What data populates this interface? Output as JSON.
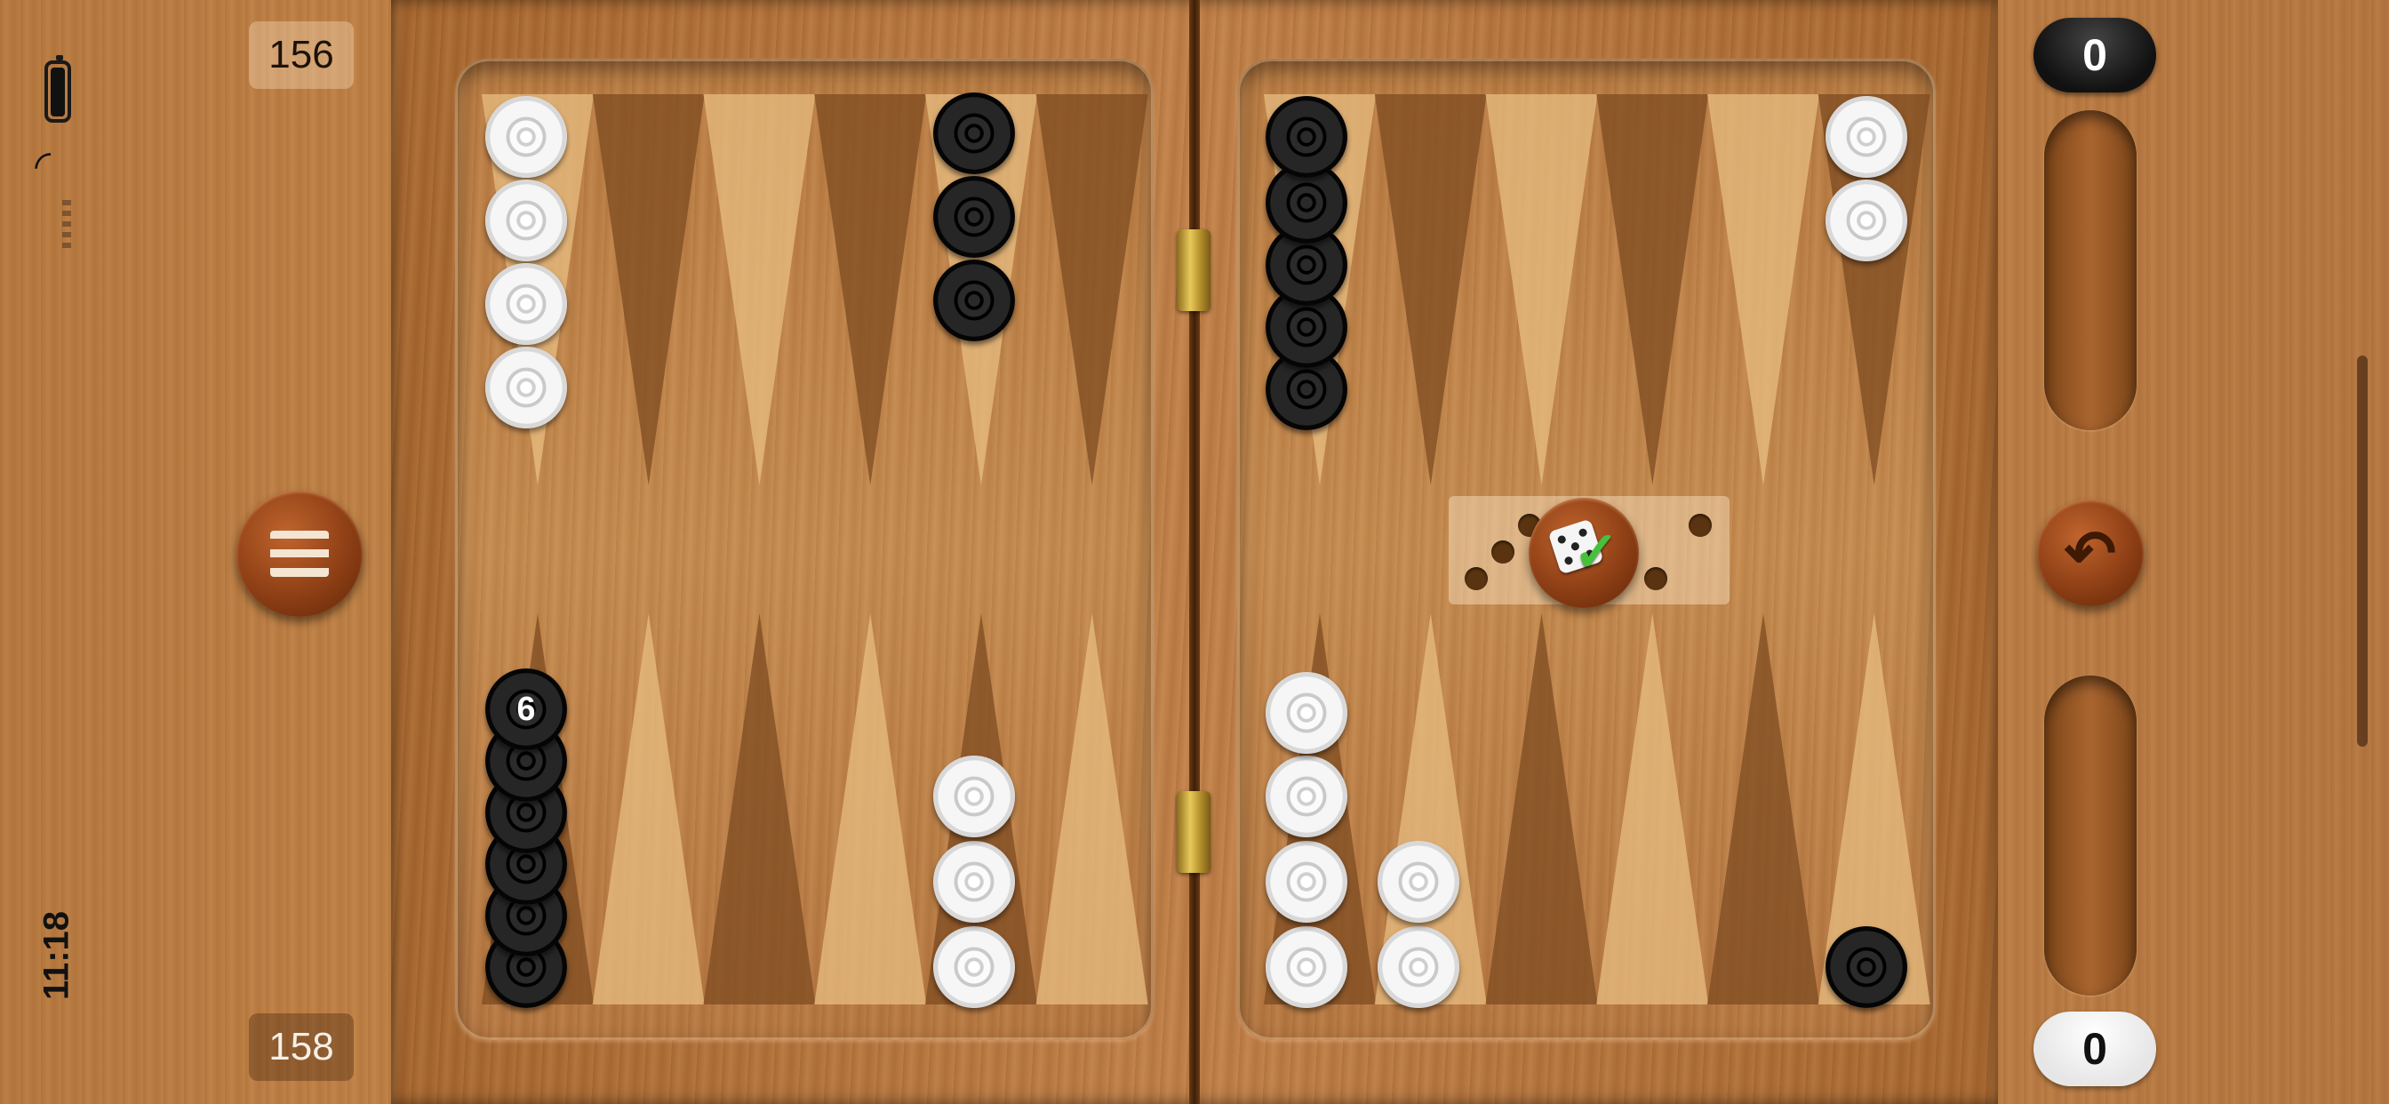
{
  "status_bar": {
    "time": "11:18",
    "battery_icon": "battery-icon",
    "wifi_icon": "wifi-icon"
  },
  "pip_counts": {
    "top": "156",
    "bottom": "158"
  },
  "scores": {
    "dark": "0",
    "light": "0"
  },
  "board": {
    "black_stack_count": "6"
  },
  "buttons": {
    "menu_icon": "menu-icon",
    "roll_icon": "dice-check-icon",
    "undo_icon": "undo-icon"
  },
  "colors": {
    "wood": "#c58a4e",
    "score_dark": "#111111",
    "score_light": "#ffffff",
    "check": "#46c23a"
  }
}
